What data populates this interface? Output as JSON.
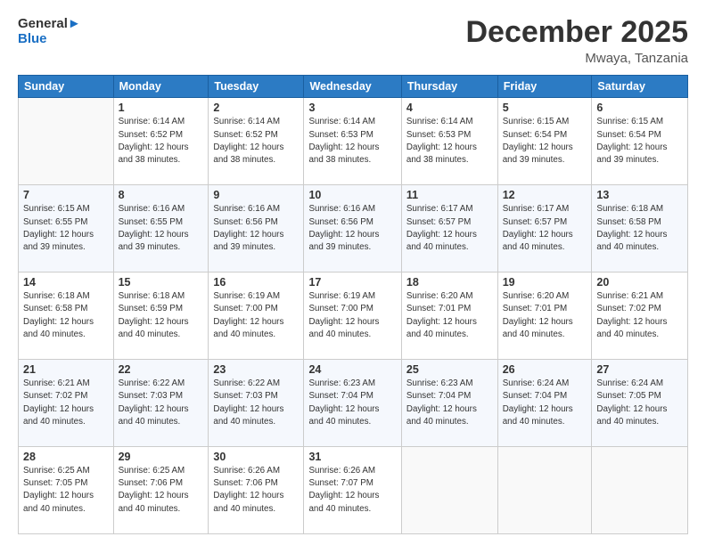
{
  "logo": {
    "line1": "General",
    "line2": "Blue"
  },
  "title": "December 2025",
  "location": "Mwaya, Tanzania",
  "days_of_week": [
    "Sunday",
    "Monday",
    "Tuesday",
    "Wednesday",
    "Thursday",
    "Friday",
    "Saturday"
  ],
  "weeks": [
    [
      {
        "day": "",
        "info": ""
      },
      {
        "day": "1",
        "info": "Sunrise: 6:14 AM\nSunset: 6:52 PM\nDaylight: 12 hours\nand 38 minutes."
      },
      {
        "day": "2",
        "info": "Sunrise: 6:14 AM\nSunset: 6:52 PM\nDaylight: 12 hours\nand 38 minutes."
      },
      {
        "day": "3",
        "info": "Sunrise: 6:14 AM\nSunset: 6:53 PM\nDaylight: 12 hours\nand 38 minutes."
      },
      {
        "day": "4",
        "info": "Sunrise: 6:14 AM\nSunset: 6:53 PM\nDaylight: 12 hours\nand 38 minutes."
      },
      {
        "day": "5",
        "info": "Sunrise: 6:15 AM\nSunset: 6:54 PM\nDaylight: 12 hours\nand 39 minutes."
      },
      {
        "day": "6",
        "info": "Sunrise: 6:15 AM\nSunset: 6:54 PM\nDaylight: 12 hours\nand 39 minutes."
      }
    ],
    [
      {
        "day": "7",
        "info": "Sunrise: 6:15 AM\nSunset: 6:55 PM\nDaylight: 12 hours\nand 39 minutes."
      },
      {
        "day": "8",
        "info": "Sunrise: 6:16 AM\nSunset: 6:55 PM\nDaylight: 12 hours\nand 39 minutes."
      },
      {
        "day": "9",
        "info": "Sunrise: 6:16 AM\nSunset: 6:56 PM\nDaylight: 12 hours\nand 39 minutes."
      },
      {
        "day": "10",
        "info": "Sunrise: 6:16 AM\nSunset: 6:56 PM\nDaylight: 12 hours\nand 39 minutes."
      },
      {
        "day": "11",
        "info": "Sunrise: 6:17 AM\nSunset: 6:57 PM\nDaylight: 12 hours\nand 40 minutes."
      },
      {
        "day": "12",
        "info": "Sunrise: 6:17 AM\nSunset: 6:57 PM\nDaylight: 12 hours\nand 40 minutes."
      },
      {
        "day": "13",
        "info": "Sunrise: 6:18 AM\nSunset: 6:58 PM\nDaylight: 12 hours\nand 40 minutes."
      }
    ],
    [
      {
        "day": "14",
        "info": "Sunrise: 6:18 AM\nSunset: 6:58 PM\nDaylight: 12 hours\nand 40 minutes."
      },
      {
        "day": "15",
        "info": "Sunrise: 6:18 AM\nSunset: 6:59 PM\nDaylight: 12 hours\nand 40 minutes."
      },
      {
        "day": "16",
        "info": "Sunrise: 6:19 AM\nSunset: 7:00 PM\nDaylight: 12 hours\nand 40 minutes."
      },
      {
        "day": "17",
        "info": "Sunrise: 6:19 AM\nSunset: 7:00 PM\nDaylight: 12 hours\nand 40 minutes."
      },
      {
        "day": "18",
        "info": "Sunrise: 6:20 AM\nSunset: 7:01 PM\nDaylight: 12 hours\nand 40 minutes."
      },
      {
        "day": "19",
        "info": "Sunrise: 6:20 AM\nSunset: 7:01 PM\nDaylight: 12 hours\nand 40 minutes."
      },
      {
        "day": "20",
        "info": "Sunrise: 6:21 AM\nSunset: 7:02 PM\nDaylight: 12 hours\nand 40 minutes."
      }
    ],
    [
      {
        "day": "21",
        "info": "Sunrise: 6:21 AM\nSunset: 7:02 PM\nDaylight: 12 hours\nand 40 minutes."
      },
      {
        "day": "22",
        "info": "Sunrise: 6:22 AM\nSunset: 7:03 PM\nDaylight: 12 hours\nand 40 minutes."
      },
      {
        "day": "23",
        "info": "Sunrise: 6:22 AM\nSunset: 7:03 PM\nDaylight: 12 hours\nand 40 minutes."
      },
      {
        "day": "24",
        "info": "Sunrise: 6:23 AM\nSunset: 7:04 PM\nDaylight: 12 hours\nand 40 minutes."
      },
      {
        "day": "25",
        "info": "Sunrise: 6:23 AM\nSunset: 7:04 PM\nDaylight: 12 hours\nand 40 minutes."
      },
      {
        "day": "26",
        "info": "Sunrise: 6:24 AM\nSunset: 7:04 PM\nDaylight: 12 hours\nand 40 minutes."
      },
      {
        "day": "27",
        "info": "Sunrise: 6:24 AM\nSunset: 7:05 PM\nDaylight: 12 hours\nand 40 minutes."
      }
    ],
    [
      {
        "day": "28",
        "info": "Sunrise: 6:25 AM\nSunset: 7:05 PM\nDaylight: 12 hours\nand 40 minutes."
      },
      {
        "day": "29",
        "info": "Sunrise: 6:25 AM\nSunset: 7:06 PM\nDaylight: 12 hours\nand 40 minutes."
      },
      {
        "day": "30",
        "info": "Sunrise: 6:26 AM\nSunset: 7:06 PM\nDaylight: 12 hours\nand 40 minutes."
      },
      {
        "day": "31",
        "info": "Sunrise: 6:26 AM\nSunset: 7:07 PM\nDaylight: 12 hours\nand 40 minutes."
      },
      {
        "day": "",
        "info": ""
      },
      {
        "day": "",
        "info": ""
      },
      {
        "day": "",
        "info": ""
      }
    ]
  ]
}
